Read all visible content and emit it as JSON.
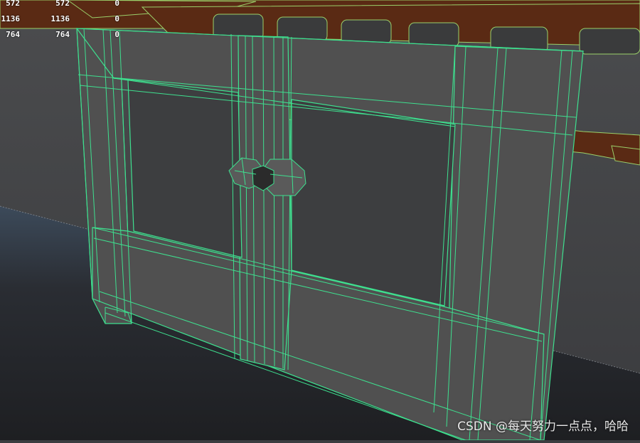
{
  "hud": {
    "rows": [
      {
        "a": "572",
        "b": "572",
        "c": "0"
      },
      {
        "a": "1136",
        "b": "1136",
        "c": "0"
      },
      {
        "a": "764",
        "b": "764",
        "c": "0"
      }
    ]
  },
  "watermark": "CSDN @每天努力一点点，哈哈",
  "colors": {
    "wire": "#3ee08f",
    "face": "#4e4e4e",
    "background_ring": "#5a2a14",
    "ground": "#1f2024"
  }
}
